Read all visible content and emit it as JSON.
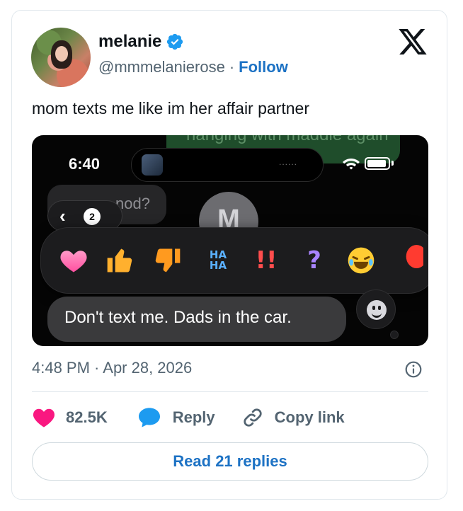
{
  "author": {
    "name": "melanie",
    "handle": "@mmmelanierose",
    "separator": "·",
    "follow_label": "Follow",
    "verified_icon": "verified-badge-icon",
    "brand_icon": "x-logo-icon"
  },
  "tweet": {
    "text": "mom texts me like im her affair partner"
  },
  "media": {
    "top_bubble_text": "hanging with maddie again",
    "status_time": "6:40",
    "island_dots": "......",
    "prev_message_fragment": "nod?",
    "back_count": "2",
    "contact_initial": "M",
    "reactions": [
      "heart",
      "thumbs-up",
      "thumbs-down",
      "HA HA",
      "!!",
      "?",
      "laughing",
      "balloon"
    ],
    "haha_line1": "HA",
    "haha_line2": "HA",
    "excl": "!!",
    "question": "?",
    "message_text": "Don't text me. Dads in the car."
  },
  "meta": {
    "timestamp": "4:48 PM · Apr 28, 2026"
  },
  "actions": {
    "like_count": "82.5K",
    "reply_label": "Reply",
    "copy_label": "Copy link"
  },
  "footer": {
    "read_replies_label": "Read 21 replies"
  },
  "colors": {
    "accent": "#1d72c4",
    "like": "#f91880",
    "reply": "#1d9bf0",
    "muted": "#536471"
  }
}
